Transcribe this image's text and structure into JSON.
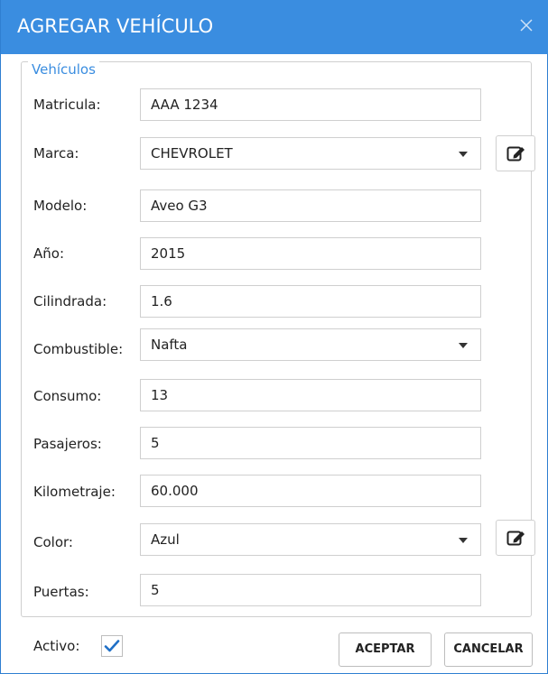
{
  "dialog": {
    "title": "AGREGAR VEHÍCULO",
    "close_icon": "close-icon"
  },
  "group": {
    "legend": "Vehículos"
  },
  "fields": {
    "matricula": {
      "label": "Matricula:",
      "value": "AAA 1234"
    },
    "marca": {
      "label": "Marca:",
      "value": "CHEVROLET"
    },
    "modelo": {
      "label": "Modelo:",
      "value": "Aveo G3"
    },
    "anio": {
      "label": "Año:",
      "value": "2015"
    },
    "cilindrada": {
      "label": "Cilindrada:",
      "value": "1.6"
    },
    "combustible": {
      "label": "Combustible:",
      "value": "Nafta"
    },
    "consumo": {
      "label": "Consumo:",
      "value": "13"
    },
    "pasajeros": {
      "label": "Pasajeros:",
      "value": "5"
    },
    "kilometraje": {
      "label": "Kilometraje:",
      "value": "60.000"
    },
    "color": {
      "label": "Color:",
      "value": "Azul"
    },
    "puertas": {
      "label": "Puertas:",
      "value": "5"
    }
  },
  "activo": {
    "label": "Activo:",
    "checked": true
  },
  "buttons": {
    "accept": "ACEPTAR",
    "cancel": "CANCELAR"
  },
  "colors": {
    "accent": "#3a8de0",
    "checkmark": "#1f6fc6"
  }
}
